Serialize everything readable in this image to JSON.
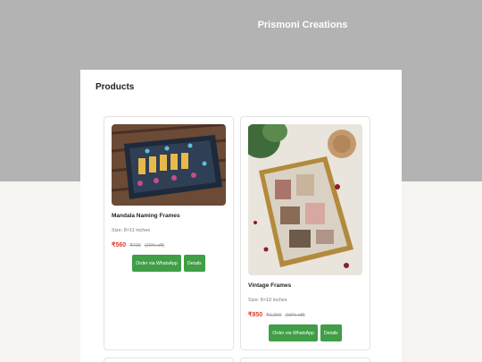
{
  "site": {
    "brand": "Prismoni Creations"
  },
  "section": {
    "title": "Products"
  },
  "products": [
    {
      "name": "Mandala Naming Frames",
      "size": "Size: 8×11 inches",
      "price": "₹560",
      "old_price": "₹700",
      "discount": "(20% off)",
      "order_label": "Order via WhatsApp",
      "details_label": "Details",
      "image_icon": "mandala-name-frame-photo"
    },
    {
      "name": "Vintage Frames",
      "size": "Size: 8×10 inches",
      "price": "₹850",
      "old_price": "₹1,000",
      "discount": "(15% off)",
      "order_label": "Order via WhatsApp",
      "details_label": "Details",
      "image_icon": "vintage-photo-frame-photo"
    }
  ],
  "colors": {
    "hero": "#b3b3b3",
    "page": "#f6f5f2",
    "accent_green": "#3f9e46",
    "price_red": "#e0402e"
  }
}
